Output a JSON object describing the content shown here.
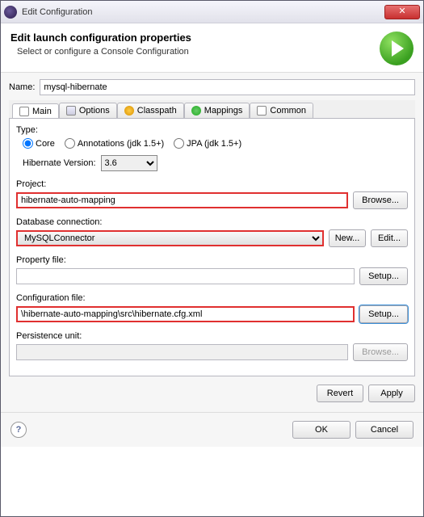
{
  "window": {
    "title": "Edit Configuration"
  },
  "header": {
    "title": "Edit launch configuration properties",
    "subtitle": "Select or configure a Console Configuration"
  },
  "name": {
    "label": "Name:",
    "value": "mysql-hibernate"
  },
  "tabs": {
    "main": "Main",
    "options": "Options",
    "classpath": "Classpath",
    "mappings": "Mappings",
    "common": "Common"
  },
  "main": {
    "type_label": "Type:",
    "type_core": "Core",
    "type_annotations": "Annotations (jdk 1.5+)",
    "type_jpa": "JPA (jdk 1.5+)",
    "hv_label": "Hibernate Version:",
    "hv_value": "3.6",
    "project": {
      "label": "Project:",
      "value": "hibernate-auto-mapping",
      "browse": "Browse..."
    },
    "dbconn": {
      "label": "Database connection:",
      "value": "MySQLConnector",
      "new": "New...",
      "edit": "Edit..."
    },
    "propfile": {
      "label": "Property file:",
      "value": "",
      "setup": "Setup..."
    },
    "cfgfile": {
      "label": "Configuration file:",
      "value": "\\hibernate-auto-mapping\\src\\hibernate.cfg.xml",
      "setup": "Setup..."
    },
    "persist": {
      "label": "Persistence unit:",
      "value": "",
      "browse": "Browse..."
    }
  },
  "buttons": {
    "revert": "Revert",
    "apply": "Apply",
    "ok": "OK",
    "cancel": "Cancel"
  }
}
